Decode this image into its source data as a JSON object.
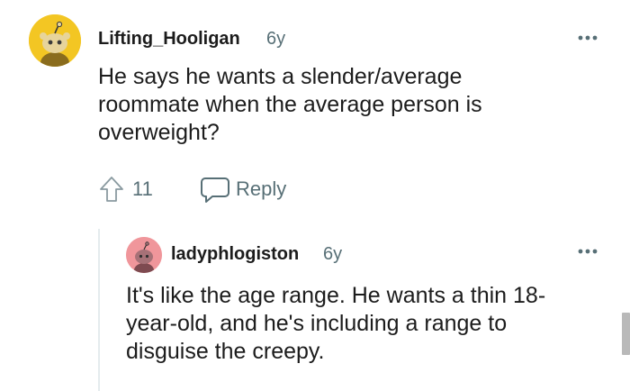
{
  "comments": [
    {
      "username": "Lifting_Hooligan",
      "age": "6y",
      "body": "He says he wants a slender/average roommate when the average person is overweight?",
      "upvotes": "11",
      "reply_label": "Reply",
      "avatar_color": "#f3c623",
      "more_icon": "more-horizontal-icon"
    },
    {
      "username": "ladyphlogiston",
      "age": "6y",
      "body": "It's like the age range. He wants a thin 18-year-old, and he's including a range to disguise the creepy.",
      "avatar_color": "#f0969b",
      "more_icon": "more-horizontal-icon"
    }
  ],
  "colors": {
    "meta": "#576f76",
    "text": "#1c1c1c",
    "thread_line": "#e5ebee"
  },
  "icons": {
    "upvote": "upvote-arrow-icon",
    "reply": "speech-bubble-icon"
  }
}
